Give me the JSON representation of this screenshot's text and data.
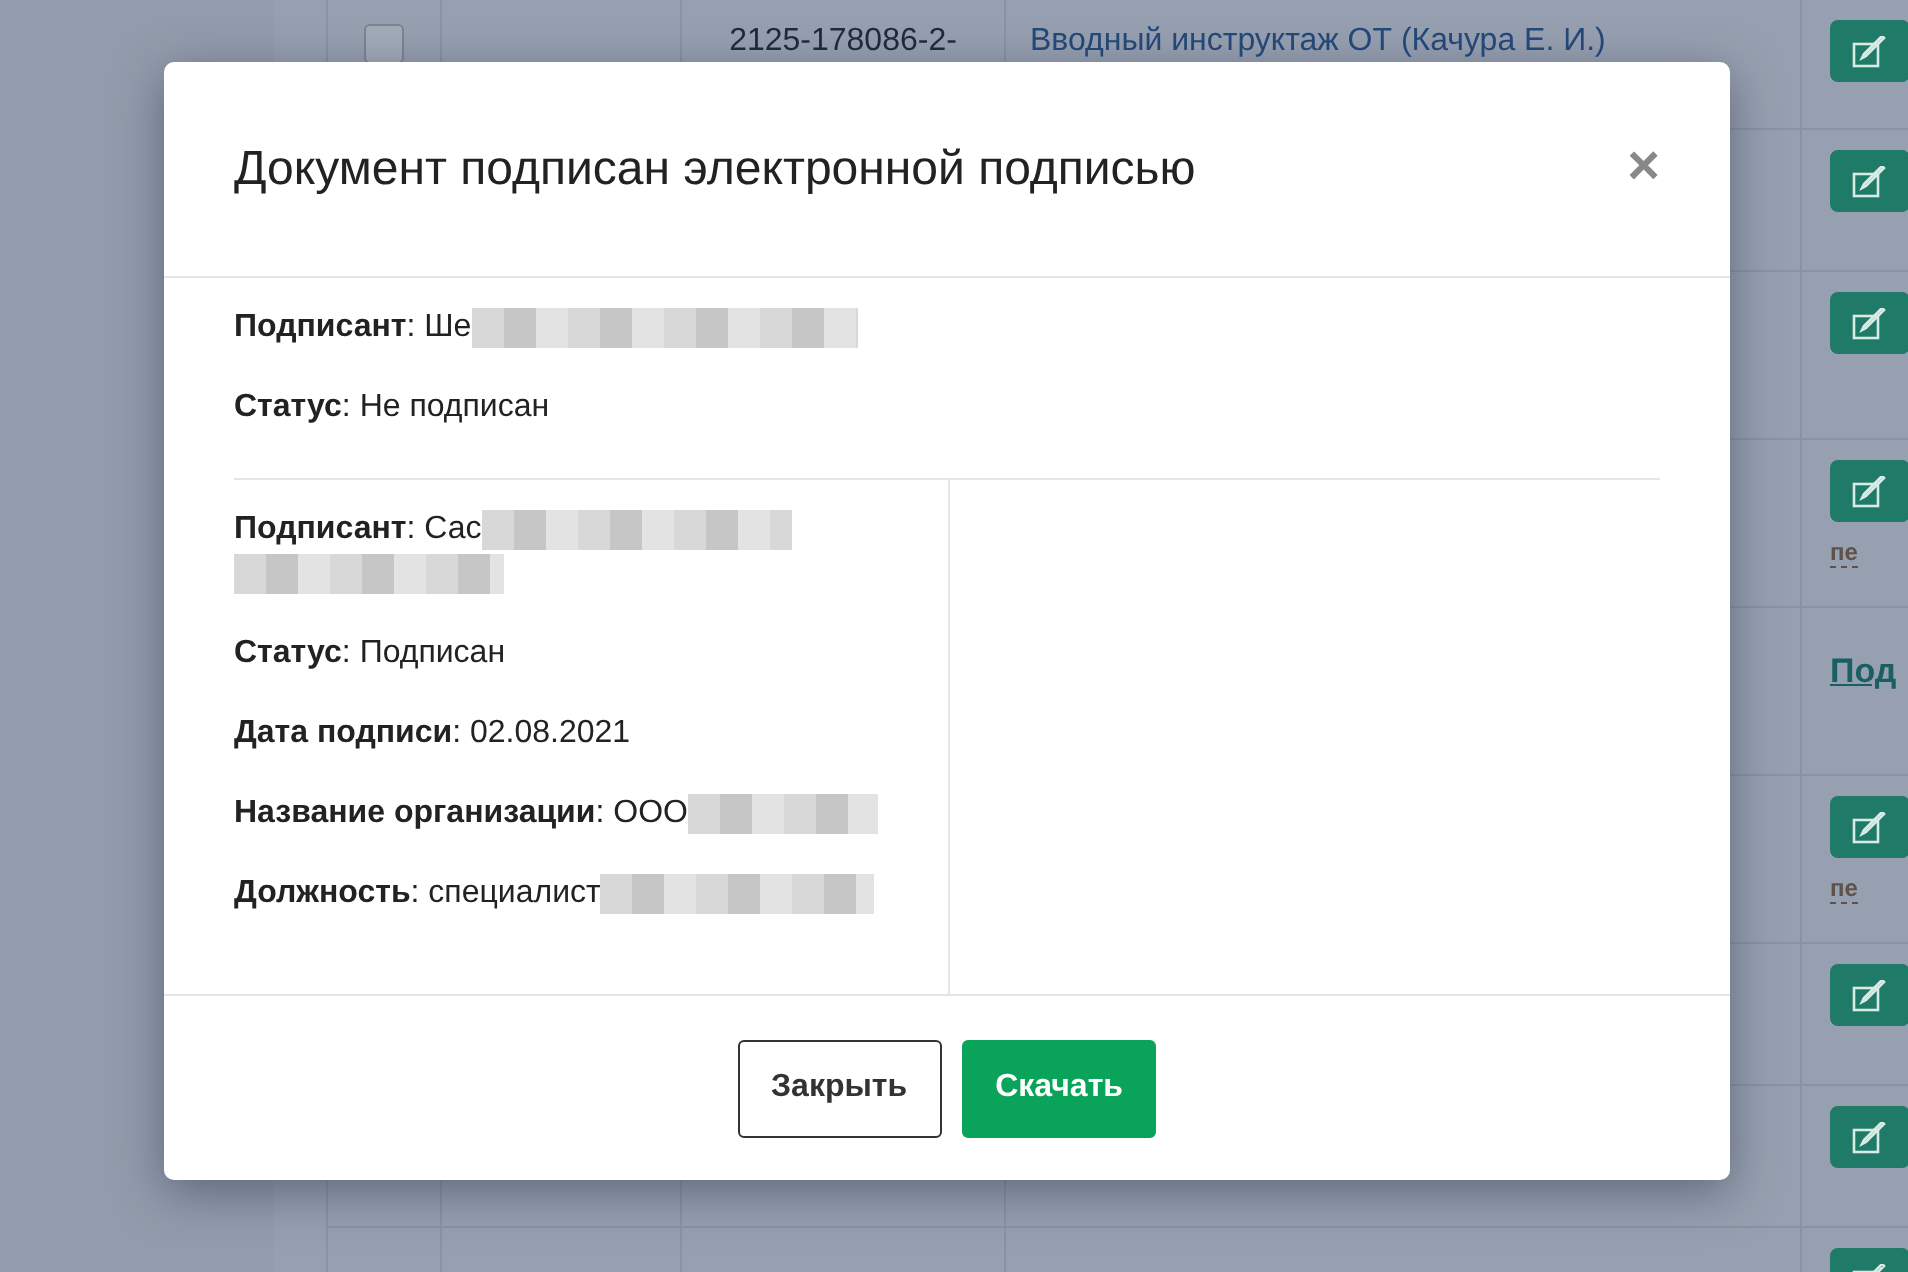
{
  "background_table": {
    "rows": [
      {
        "checked": false,
        "number": "2125-178086-2-",
        "title": "Вводный инструктаж ОТ (Качура Е. И.)",
        "action": {
          "kind": "edit"
        }
      },
      {
        "action": {
          "kind": "edit"
        }
      },
      {
        "action": {
          "kind": "edit"
        }
      },
      {
        "action": {
          "kind": "edit",
          "note": "пе"
        }
      },
      {
        "action": {
          "kind": "link",
          "label": "Под"
        }
      },
      {
        "action": {
          "kind": "edit",
          "note": "пе"
        }
      },
      {
        "action": {
          "kind": "edit"
        }
      },
      {
        "action": {
          "kind": "edit"
        }
      },
      {
        "action": {
          "kind": "edit"
        }
      }
    ]
  },
  "dialog": {
    "title": "Документ подписан электронной подписью",
    "close": "×",
    "signers": [
      {
        "fields": [
          {
            "text": "**Подписант**: Ше",
            "redacted": true
          },
          {
            "text": "**Статус**: Не подписан",
            "redacted": false
          }
        ]
      },
      {
        "fields": [
          {
            "text": "**Подписант**: Сас",
            "redacted": true
          },
          {
            "text": "**Статус**: Подписан",
            "redacted": false
          },
          {
            "text": "**Дата подписи**: 02.08.2021",
            "redacted": false
          },
          {
            "text": "**Название организации**: ООО",
            "redacted": true
          },
          {
            "text": "**Должность**: специалист",
            "redacted": true
          }
        ]
      }
    ],
    "buttons": [
      {
        "label": "Закрыть",
        "kind": "secondary"
      },
      {
        "label": "Скачать",
        "kind": "primary"
      }
    ]
  }
}
